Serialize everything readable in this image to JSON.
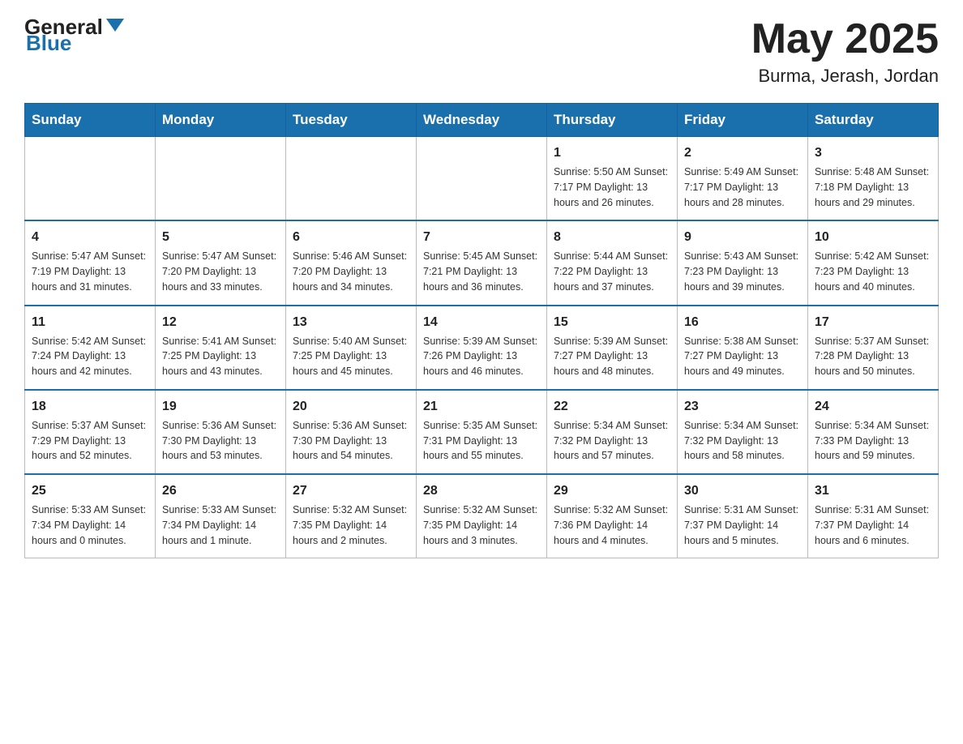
{
  "header": {
    "logo_general": "General",
    "logo_blue": "Blue",
    "month_title": "May 2025",
    "location": "Burma, Jerash, Jordan"
  },
  "calendar": {
    "days_of_week": [
      "Sunday",
      "Monday",
      "Tuesday",
      "Wednesday",
      "Thursday",
      "Friday",
      "Saturday"
    ],
    "weeks": [
      [
        {
          "day": "",
          "info": ""
        },
        {
          "day": "",
          "info": ""
        },
        {
          "day": "",
          "info": ""
        },
        {
          "day": "",
          "info": ""
        },
        {
          "day": "1",
          "info": "Sunrise: 5:50 AM\nSunset: 7:17 PM\nDaylight: 13 hours and 26 minutes."
        },
        {
          "day": "2",
          "info": "Sunrise: 5:49 AM\nSunset: 7:17 PM\nDaylight: 13 hours and 28 minutes."
        },
        {
          "day": "3",
          "info": "Sunrise: 5:48 AM\nSunset: 7:18 PM\nDaylight: 13 hours and 29 minutes."
        }
      ],
      [
        {
          "day": "4",
          "info": "Sunrise: 5:47 AM\nSunset: 7:19 PM\nDaylight: 13 hours and 31 minutes."
        },
        {
          "day": "5",
          "info": "Sunrise: 5:47 AM\nSunset: 7:20 PM\nDaylight: 13 hours and 33 minutes."
        },
        {
          "day": "6",
          "info": "Sunrise: 5:46 AM\nSunset: 7:20 PM\nDaylight: 13 hours and 34 minutes."
        },
        {
          "day": "7",
          "info": "Sunrise: 5:45 AM\nSunset: 7:21 PM\nDaylight: 13 hours and 36 minutes."
        },
        {
          "day": "8",
          "info": "Sunrise: 5:44 AM\nSunset: 7:22 PM\nDaylight: 13 hours and 37 minutes."
        },
        {
          "day": "9",
          "info": "Sunrise: 5:43 AM\nSunset: 7:23 PM\nDaylight: 13 hours and 39 minutes."
        },
        {
          "day": "10",
          "info": "Sunrise: 5:42 AM\nSunset: 7:23 PM\nDaylight: 13 hours and 40 minutes."
        }
      ],
      [
        {
          "day": "11",
          "info": "Sunrise: 5:42 AM\nSunset: 7:24 PM\nDaylight: 13 hours and 42 minutes."
        },
        {
          "day": "12",
          "info": "Sunrise: 5:41 AM\nSunset: 7:25 PM\nDaylight: 13 hours and 43 minutes."
        },
        {
          "day": "13",
          "info": "Sunrise: 5:40 AM\nSunset: 7:25 PM\nDaylight: 13 hours and 45 minutes."
        },
        {
          "day": "14",
          "info": "Sunrise: 5:39 AM\nSunset: 7:26 PM\nDaylight: 13 hours and 46 minutes."
        },
        {
          "day": "15",
          "info": "Sunrise: 5:39 AM\nSunset: 7:27 PM\nDaylight: 13 hours and 48 minutes."
        },
        {
          "day": "16",
          "info": "Sunrise: 5:38 AM\nSunset: 7:27 PM\nDaylight: 13 hours and 49 minutes."
        },
        {
          "day": "17",
          "info": "Sunrise: 5:37 AM\nSunset: 7:28 PM\nDaylight: 13 hours and 50 minutes."
        }
      ],
      [
        {
          "day": "18",
          "info": "Sunrise: 5:37 AM\nSunset: 7:29 PM\nDaylight: 13 hours and 52 minutes."
        },
        {
          "day": "19",
          "info": "Sunrise: 5:36 AM\nSunset: 7:30 PM\nDaylight: 13 hours and 53 minutes."
        },
        {
          "day": "20",
          "info": "Sunrise: 5:36 AM\nSunset: 7:30 PM\nDaylight: 13 hours and 54 minutes."
        },
        {
          "day": "21",
          "info": "Sunrise: 5:35 AM\nSunset: 7:31 PM\nDaylight: 13 hours and 55 minutes."
        },
        {
          "day": "22",
          "info": "Sunrise: 5:34 AM\nSunset: 7:32 PM\nDaylight: 13 hours and 57 minutes."
        },
        {
          "day": "23",
          "info": "Sunrise: 5:34 AM\nSunset: 7:32 PM\nDaylight: 13 hours and 58 minutes."
        },
        {
          "day": "24",
          "info": "Sunrise: 5:34 AM\nSunset: 7:33 PM\nDaylight: 13 hours and 59 minutes."
        }
      ],
      [
        {
          "day": "25",
          "info": "Sunrise: 5:33 AM\nSunset: 7:34 PM\nDaylight: 14 hours and 0 minutes."
        },
        {
          "day": "26",
          "info": "Sunrise: 5:33 AM\nSunset: 7:34 PM\nDaylight: 14 hours and 1 minute."
        },
        {
          "day": "27",
          "info": "Sunrise: 5:32 AM\nSunset: 7:35 PM\nDaylight: 14 hours and 2 minutes."
        },
        {
          "day": "28",
          "info": "Sunrise: 5:32 AM\nSunset: 7:35 PM\nDaylight: 14 hours and 3 minutes."
        },
        {
          "day": "29",
          "info": "Sunrise: 5:32 AM\nSunset: 7:36 PM\nDaylight: 14 hours and 4 minutes."
        },
        {
          "day": "30",
          "info": "Sunrise: 5:31 AM\nSunset: 7:37 PM\nDaylight: 14 hours and 5 minutes."
        },
        {
          "day": "31",
          "info": "Sunrise: 5:31 AM\nSunset: 7:37 PM\nDaylight: 14 hours and 6 minutes."
        }
      ]
    ]
  }
}
